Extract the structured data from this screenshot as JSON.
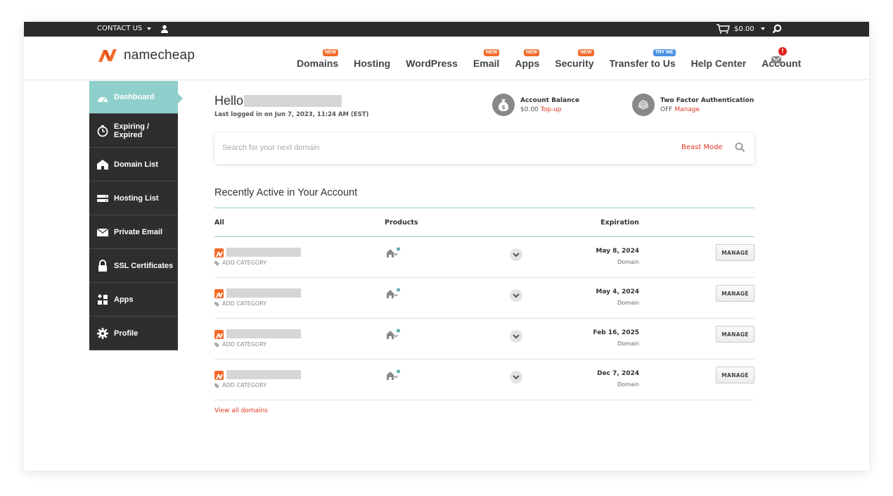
{
  "topbar": {
    "contact_label": "CONTACT US",
    "cart_total": "$0.00"
  },
  "header": {
    "logo_text": "namecheap",
    "nav": [
      {
        "label": "Domains",
        "badge": "NEW",
        "badge_color": "#f26a2a"
      },
      {
        "label": "Hosting",
        "badge": "",
        "badge_color": ""
      },
      {
        "label": "WordPress",
        "badge": "",
        "badge_color": ""
      },
      {
        "label": "Email",
        "badge": "NEW",
        "badge_color": "#f26a2a"
      },
      {
        "label": "Apps",
        "badge": "NEW",
        "badge_color": "#f26a2a"
      },
      {
        "label": "Security",
        "badge": "NEW",
        "badge_color": "#f26a2a"
      },
      {
        "label": "Transfer to Us",
        "badge": "TRY ME",
        "badge_color": "#4a90e2"
      },
      {
        "label": "Help Center",
        "badge": "",
        "badge_color": ""
      },
      {
        "label": "Account",
        "badge": "",
        "badge_color": ""
      }
    ],
    "notification_count": "!"
  },
  "sidebar": {
    "items": [
      {
        "label": "Dashboard",
        "icon": "gauge-icon",
        "active": true
      },
      {
        "label": "Expiring / Expired",
        "icon": "stopwatch-icon",
        "active": false
      },
      {
        "label": "Domain List",
        "icon": "house-icon",
        "active": false
      },
      {
        "label": "Hosting List",
        "icon": "server-icon",
        "active": false
      },
      {
        "label": "Private Email",
        "icon": "envelope-icon",
        "active": false
      },
      {
        "label": "SSL Certificates",
        "icon": "lock-icon",
        "active": false
      },
      {
        "label": "Apps",
        "icon": "apps-icon",
        "active": false
      },
      {
        "label": "Profile",
        "icon": "gear-icon",
        "active": false
      }
    ]
  },
  "greeting": {
    "hello": "Hello",
    "last_login": "Last logged in on Jun 7, 2023, 11:24 AM (EST)"
  },
  "account_balance": {
    "title": "Account Balance",
    "amount": "$0.00",
    "action": "Top-up"
  },
  "two_factor": {
    "title": "Two Factor Authentication",
    "status": "OFF",
    "action": "Manage"
  },
  "search": {
    "placeholder": "Search for your next domain",
    "beast_mode": "Beast Mode"
  },
  "recent": {
    "title": "Recently Active in Your Account",
    "headers": {
      "all": "All",
      "products": "Products",
      "expiration": "Expiration"
    },
    "rows": [
      {
        "add_category": "ADD CATEGORY",
        "date": "May 8, 2024",
        "type": "Domain",
        "manage": "MANAGE"
      },
      {
        "add_category": "ADD CATEGORY",
        "date": "May 4, 2024",
        "type": "Domain",
        "manage": "MANAGE"
      },
      {
        "add_category": "ADD CATEGORY",
        "date": "Feb 16, 2025",
        "type": "Domain",
        "manage": "MANAGE"
      },
      {
        "add_category": "ADD CATEGORY",
        "date": "Dec 7, 2024",
        "type": "Domain",
        "manage": "MANAGE"
      }
    ],
    "view_all": "View all domains"
  },
  "colors": {
    "accent": "#de3723",
    "teal": "#8fcfcb",
    "sidebar_bg": "#2e2e2e",
    "brand_orange": "#f26a2a"
  }
}
